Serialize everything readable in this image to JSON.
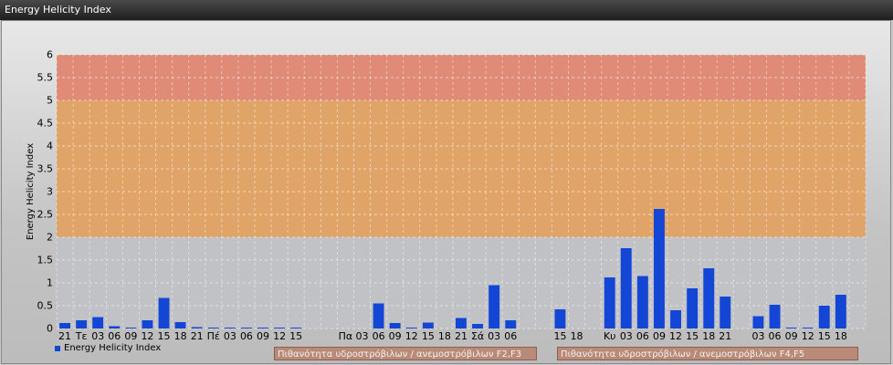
{
  "window": {
    "title": "Energy Helicity Index"
  },
  "colors": {
    "bar": "#1446d6",
    "band_high": "#e08a78",
    "band_mid": "#e0a468",
    "band_low": "#c0c2c6"
  },
  "chart_data": {
    "type": "bar",
    "title": "",
    "ylabel": "Energy Helicity Index",
    "ylim": [
      0,
      6
    ],
    "yticks": [
      "0",
      "0.5",
      "1",
      "1.5",
      "2",
      "2.5",
      "3",
      "3.5",
      "4",
      "4.5",
      "5",
      "5.5",
      "6"
    ],
    "threshold_bands": [
      {
        "from": 0,
        "to": 2,
        "color": "#c0c2c6"
      },
      {
        "from": 2,
        "to": 5,
        "color": "#e0a468"
      },
      {
        "from": 5,
        "to": 6,
        "color": "#e08a78"
      }
    ],
    "categories": [
      "21",
      "Τε",
      "03",
      "06",
      "09",
      "12",
      "15",
      "18",
      "21",
      "Πέ",
      "03",
      "06",
      "09",
      "12",
      "15",
      "",
      "",
      "Πα",
      "03",
      "06",
      "09",
      "12",
      "15",
      "18",
      "21",
      "Σά",
      "03",
      "06",
      "",
      "",
      "15",
      "18",
      "",
      "Κυ",
      "03",
      "06",
      "09",
      "12",
      "15",
      "18",
      "21",
      "",
      "03",
      "06",
      "09",
      "12",
      "15",
      "18",
      ""
    ],
    "series": [
      {
        "name": "Energy Helicity Index",
        "values": [
          0.12,
          0.18,
          0.25,
          0.05,
          0.02,
          0.18,
          0.67,
          0.14,
          0.03,
          0.02,
          0.02,
          0.02,
          0.02,
          0.02,
          0.02,
          0.0,
          0.0,
          0.0,
          0.0,
          0.55,
          0.12,
          0.02,
          0.13,
          0.0,
          0.23,
          0.1,
          0.95,
          0.18,
          0.0,
          0.0,
          0.42,
          0.0,
          0.0,
          1.12,
          1.76,
          1.15,
          2.62,
          0.4,
          0.88,
          1.32,
          0.7,
          0.0,
          0.27,
          0.52,
          0.02,
          0.02,
          0.5,
          0.74,
          0.0
        ]
      }
    ],
    "legend": {
      "position": "bottom-left"
    }
  },
  "footer": {
    "legend_label": "Energy Helicity Index",
    "notes": [
      "Πιθανότητα υδροστρόβιλων / ανεμοστρόβιλων F2,F3",
      "Πιθανότητα υδροστρόβιλων / ανεμοστρόβιλων F4,F5"
    ]
  }
}
